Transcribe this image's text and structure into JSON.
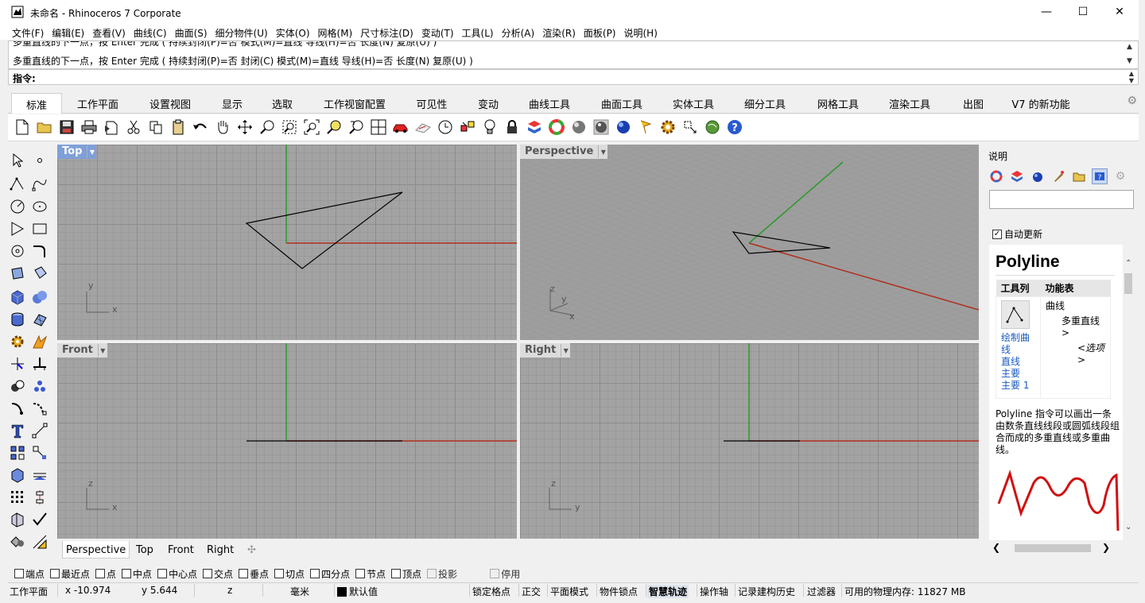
{
  "window": {
    "title": "未命名 - Rhinoceros 7 Corporate",
    "minimize": "—",
    "maximize": "☐",
    "close": "✕"
  },
  "menu": [
    "文件(F)",
    "编辑(E)",
    "查看(V)",
    "曲线(C)",
    "曲面(S)",
    "细分物件(U)",
    "实体(O)",
    "网格(M)",
    "尺寸标注(D)",
    "变动(T)",
    "工具(L)",
    "分析(A)",
    "渲染(R)",
    "面板(P)",
    "说明(H)"
  ],
  "command": {
    "history_line1": "多重直线的下一点，按 Enter 完成 ( 持续封闭(P)=否  模式(M)=直线  导线(H)=否  长度(N)  复原(U) )",
    "history_line2": "多重直线的下一点，按 Enter 完成 ( 持续封闭(P)=否  封闭(C)  模式(M)=直线  导线(H)=否  长度(N)  复原(U) )",
    "prompt": "指令:"
  },
  "tabs": [
    "标准",
    "工作平面",
    "设置视图",
    "显示",
    "选取",
    "工作视窗配置",
    "可见性",
    "变动",
    "曲线工具",
    "曲面工具",
    "实体工具",
    "细分工具",
    "网格工具",
    "渲染工具",
    "出图",
    "V7 的新功能"
  ],
  "active_tab": "标准",
  "viewports": {
    "top": {
      "label": "Top",
      "axis1": "y",
      "axis2": "x"
    },
    "perspective": {
      "label": "Perspective",
      "axis1": "z",
      "axis2": "y",
      "axis3": "x"
    },
    "front": {
      "label": "Front",
      "axis1": "z",
      "axis2": "x"
    },
    "right": {
      "label": "Right",
      "axis1": "z",
      "axis2": "y"
    }
  },
  "viewport_tabs": [
    "Perspective",
    "Top",
    "Front",
    "Right"
  ],
  "viewport_tab_add": "✣",
  "active_viewport_tab": "Perspective",
  "panel": {
    "title": "说明",
    "auto_update": "自动更新",
    "help": {
      "title": "Polyline",
      "col1": "工具列",
      "col2": "功能表",
      "menu_path1": "曲线",
      "menu_path2": "多重直线 >",
      "menu_path3": "<选项>",
      "toolbar_links": [
        "绘制曲线",
        "直线",
        "主要",
        "主要 1"
      ],
      "description": "Polyline 指令可以画出一条由数条直线线段或圆弧线段组合而成的多重直线或多重曲线。"
    }
  },
  "osnaps": [
    {
      "label": "端点",
      "checked": false,
      "disabled": false
    },
    {
      "label": "最近点",
      "checked": false,
      "disabled": false
    },
    {
      "label": "点",
      "checked": false,
      "disabled": false
    },
    {
      "label": "中点",
      "checked": false,
      "disabled": false
    },
    {
      "label": "中心点",
      "checked": false,
      "disabled": false
    },
    {
      "label": "交点",
      "checked": false,
      "disabled": false
    },
    {
      "label": "垂点",
      "checked": false,
      "disabled": false
    },
    {
      "label": "切点",
      "checked": false,
      "disabled": false
    },
    {
      "label": "四分点",
      "checked": false,
      "disabled": false
    },
    {
      "label": "节点",
      "checked": false,
      "disabled": false
    },
    {
      "label": "顶点",
      "checked": false,
      "disabled": false
    },
    {
      "label": "投影",
      "checked": false,
      "disabled": true
    },
    {
      "label": "停用",
      "checked": false,
      "disabled": true
    }
  ],
  "status": {
    "cplane": "工作平面",
    "x": "x -10.974",
    "y": "y 5.644",
    "z": "z",
    "units": "毫米",
    "layer": "默认值",
    "grid_snap": "锁定格点",
    "ortho": "正交",
    "planar": "平面模式",
    "osnap": "物件锁点",
    "smarttrack": "智慧轨迹",
    "gumball": "操作轴",
    "history": "记录建构历史",
    "filter": "过滤器",
    "memory": "可用的物理内存: 11827 MB"
  },
  "colors": {
    "x_axis": "#b03020",
    "y_axis": "#2a9a2a",
    "active_label": "#7f9fd8",
    "grid_bg": "#a3a3a3"
  }
}
